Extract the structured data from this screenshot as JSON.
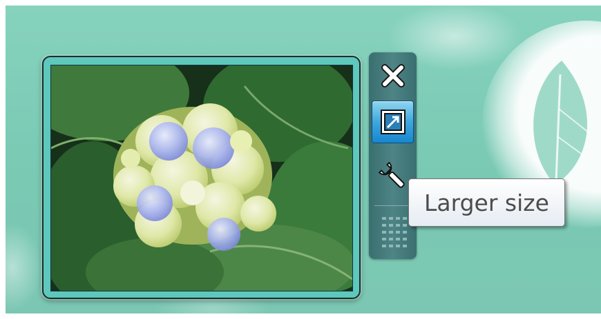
{
  "tooltip": {
    "text": "Larger size"
  },
  "gadget": {
    "buttons": [
      {
        "id": "close",
        "icon": "close-icon"
      },
      {
        "id": "larger-size",
        "icon": "resize-icon",
        "state": "hover"
      },
      {
        "id": "options",
        "icon": "wrench-icon"
      },
      {
        "id": "drag",
        "icon": "drag-grip-icon"
      }
    ]
  },
  "colors": {
    "frame": "#5dc8bb",
    "toolbar": "#4f8486",
    "hover_button": "#3fa7de",
    "desktop": "#79c9b3"
  }
}
